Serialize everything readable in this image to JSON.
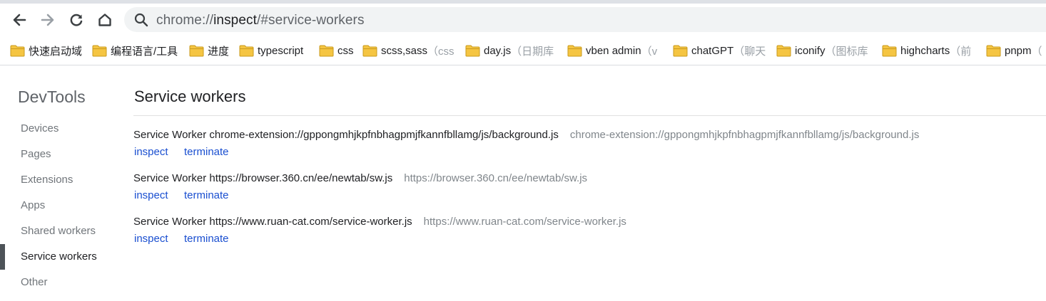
{
  "browser": {
    "address_scheme": "chrome://",
    "address_host": "inspect",
    "address_rest": "/#service-workers"
  },
  "bookmarks": [
    {
      "label": "快速启动域",
      "faded": ""
    },
    {
      "label": "编程语言/工具",
      "faded": ""
    },
    {
      "label": "进度",
      "faded": ""
    },
    {
      "label": "typescript",
      "faded": ""
    },
    {
      "label": "css",
      "faded": ""
    },
    {
      "label": "scss,sass",
      "faded": "（css"
    },
    {
      "label": "day.js",
      "faded": "（日期库"
    },
    {
      "label": "vben admin",
      "faded": "（v"
    },
    {
      "label": "chatGPT",
      "faded": "（聊天"
    },
    {
      "label": "iconify",
      "faded": "（图标库"
    },
    {
      "label": "highcharts",
      "faded": "（前"
    },
    {
      "label": "pnpm",
      "faded": "（"
    }
  ],
  "sidebar": {
    "title": "DevTools",
    "items": [
      {
        "label": "Devices"
      },
      {
        "label": "Pages"
      },
      {
        "label": "Extensions"
      },
      {
        "label": "Apps"
      },
      {
        "label": "Shared workers"
      },
      {
        "label": "Service workers"
      },
      {
        "label": "Other"
      }
    ]
  },
  "main": {
    "title": "Service workers",
    "workers": [
      {
        "name": "Service Worker chrome-extension://gppongmhjkpfnbhagpmjfkannfbllamg/js/background.js",
        "url": "chrome-extension://gppongmhjkpfnbhagpmjfkannfbllamg/js/background.js",
        "inspect": "inspect",
        "terminate": "terminate"
      },
      {
        "name": "Service Worker https://browser.360.cn/ee/newtab/sw.js",
        "url": "https://browser.360.cn/ee/newtab/sw.js",
        "inspect": "inspect",
        "terminate": "terminate"
      },
      {
        "name": "Service Worker https://www.ruan-cat.com/service-worker.js",
        "url": "https://www.ruan-cat.com/service-worker.js",
        "inspect": "inspect",
        "terminate": "terminate"
      }
    ]
  },
  "icons": {
    "back": "back-arrow-icon",
    "forward": "forward-arrow-icon",
    "reload": "reload-icon",
    "home": "home-icon",
    "search": "search-icon",
    "folder": "folder-icon"
  },
  "colors": {
    "folder": "#f5c542",
    "link": "#1a4fd0",
    "active_bar": "#4d5358"
  }
}
